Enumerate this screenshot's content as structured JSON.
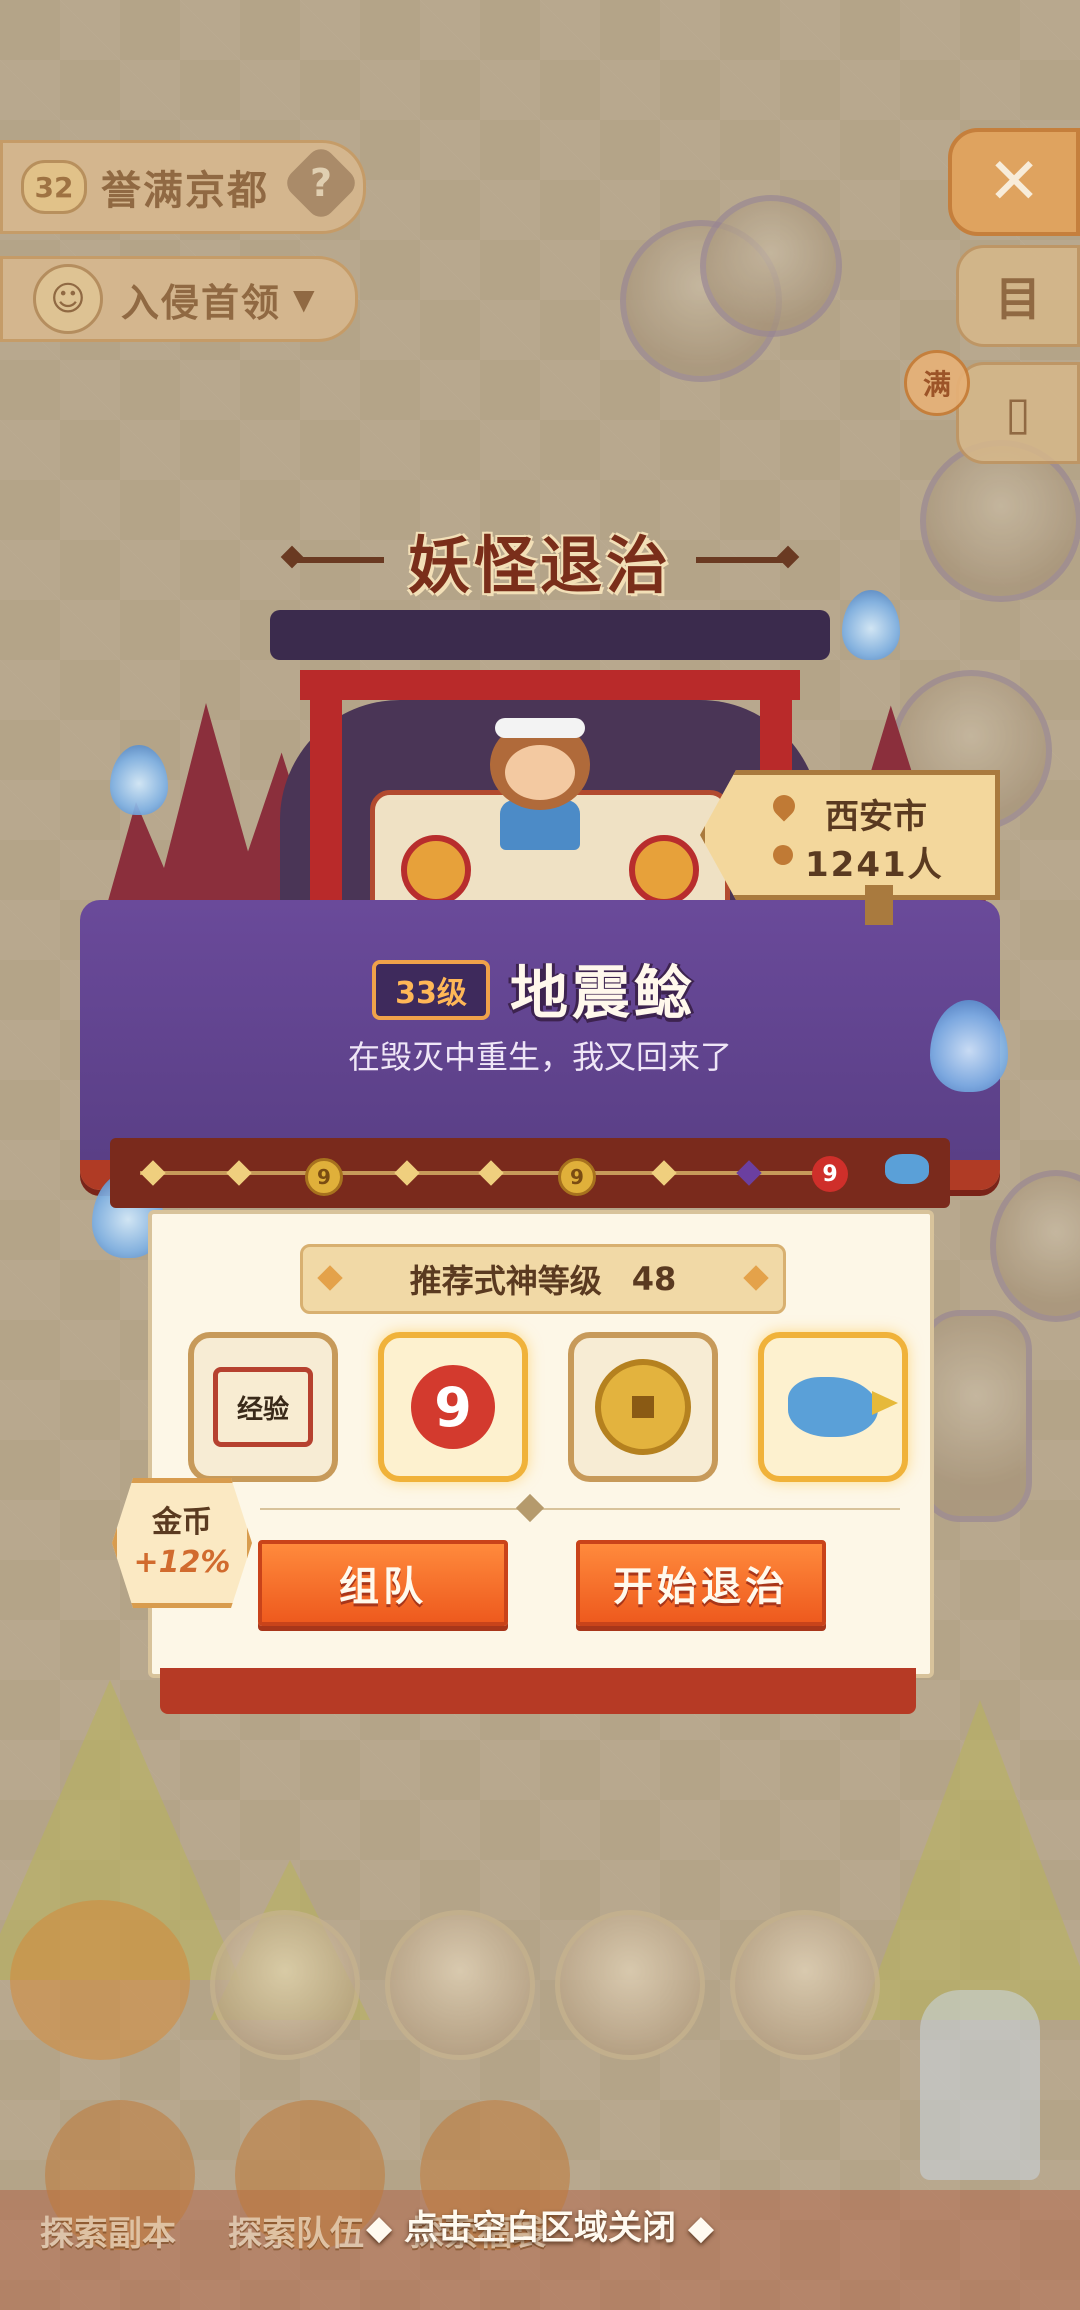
{
  "header": {
    "region_level": "32",
    "region_name": "誉满京都",
    "region_help": "?",
    "boss_filter": "入侵首领",
    "boss_caret": "▼",
    "close_symbol": "✕",
    "side_label": "目",
    "full_tag": "满"
  },
  "event": {
    "title": "妖怪退治",
    "level_tag": "33级",
    "monster_name": "地震鲶",
    "monster_desc": "在毁灭中重生，我又回来了",
    "location_city": "西安市",
    "location_count": "1241人"
  },
  "progress": {
    "coin_mark": "9",
    "red_mark": "9"
  },
  "panel": {
    "recommend_label": "推荐式神等级",
    "recommend_value": "48",
    "rewards": [
      {
        "icon": "exp-scroll-icon",
        "label": "经验"
      },
      {
        "icon": "nine-token-icon",
        "label": "9"
      },
      {
        "icon": "gold-coin-icon",
        "label": ""
      },
      {
        "icon": "bird-charm-icon",
        "label": ""
      }
    ],
    "coin_bonus_label": "金币",
    "coin_bonus_value": "+12%",
    "team_button": "组队",
    "start_button": "开始退治"
  },
  "footer": {
    "close_hint": "◆ 点击空白区域关闭 ◆",
    "tab1": "探索副本",
    "tab2": "探索队伍",
    "tab3": "探索福袋"
  }
}
